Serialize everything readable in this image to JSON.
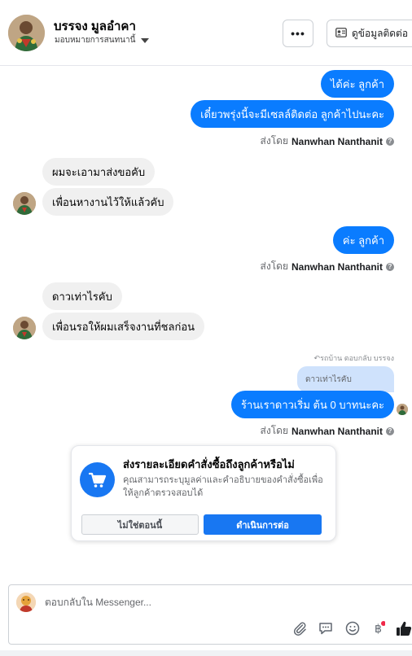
{
  "header": {
    "contact_name": "บรรจง มูลอำคา",
    "assign_label": "มอบหมายการสนทนานี้",
    "more_label": "•••",
    "contact_info_label": "ดูข้อมูลติดต่อ"
  },
  "messages": [
    {
      "dir": "out",
      "text": "ได้ค่ะ ลูกค้า"
    },
    {
      "dir": "out",
      "text": "เดี๋ยวพรุ่งนี้จะมีเซลล์ติดต่อ ลูกค้าไปนะคะ"
    },
    {
      "dir": "in",
      "text": "ผมจะเอามาส่งขอคับ"
    },
    {
      "dir": "in",
      "text": "เพื่อนหางานไว้ให้แล้วคับ"
    },
    {
      "dir": "out",
      "text": "ค่ะ ลูกค้า"
    },
    {
      "dir": "in",
      "text": "ดาวเท่าไรคับ"
    },
    {
      "dir": "in",
      "text": "เพื่อนรอให้ผมเสร็จงานที่ชลก่อน"
    },
    {
      "dir": "out",
      "text": "ร้านเราดาวเริ่ม ต้น 0 บาทนะคะ"
    }
  ],
  "sent_by": {
    "prefix": "ส่งโดย",
    "name": "Nanwhan Nanthanit",
    "help": "?"
  },
  "reply": {
    "meta": "รถบ้าน ตอบกลับ บรรจง",
    "quoted_text": "ดาวเท่าไรคับ"
  },
  "order_card": {
    "title": "ส่งรายละเอียดคำสั่งซื้อถึงลูกค้าหรือไม่",
    "description": "คุณสามารถระบุมูลค่าและคำอธิบายของคำสั่งซื้อเพื่อให้ลูกค้าตรวจสอบได้",
    "decline_label": "ไม่ใช่ตอนนี้",
    "continue_label": "ดำเนินการต่อ"
  },
  "composer": {
    "placeholder": "ตอบกลับใน Messenger..."
  },
  "colors": {
    "outgoing_bubble": "#0a7cff",
    "incoming_bubble": "#f0f0f0",
    "primary": "#1877f2"
  },
  "icons": [
    "more-icon",
    "contact-card-icon",
    "cart-icon",
    "attachment-icon",
    "saved-reply-icon",
    "emoji-icon",
    "baht-icon",
    "like-icon"
  ]
}
